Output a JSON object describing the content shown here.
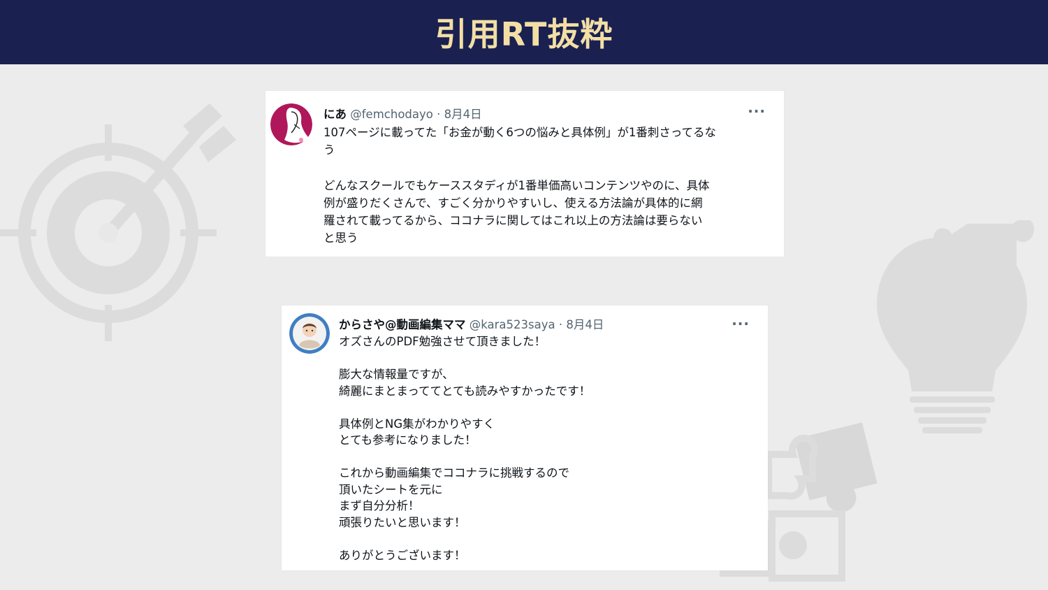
{
  "header": {
    "title": "引用RT抜粋"
  },
  "colors": {
    "header_bg": "#1a2150",
    "title": "#f3dfa6",
    "background": "#ececec",
    "deco": "#dcdcdc"
  },
  "decorations": [
    "target-arrow-icon",
    "lightbulb-puzzle-icon",
    "puzzle-pieces-icon"
  ],
  "tweets": [
    {
      "name": "にあ",
      "handle": "@femchodayo",
      "date": "· 8月4日",
      "more": "···",
      "paragraphs": [
        [
          "107ページに載ってた「お金が動く6つの悩みと具体例」が1番刺さってるな",
          "う"
        ],
        [
          "どんなスクールでもケーススタディが1番単価高いコンテンツやのに、具体",
          "例が盛りだくさんで、すごく分かりやすいし、使える方法論が具体的に網",
          "羅されて載ってるから、ココナラに関してはこれ以上の方法論は要らない",
          "と思う"
        ]
      ]
    },
    {
      "name": "からさや@動画編集ママ",
      "handle": "@kara523saya",
      "date": "· 8月4日",
      "more": "···",
      "paragraphs": [
        [
          "オズさんのPDF勉強させて頂きました！"
        ],
        [
          "膨大な情報量ですが、",
          "綺麗にまとまっててとても読みやすかったです！"
        ],
        [
          "具体例とNG集がわかりやすく",
          "とても参考になりました！"
        ],
        [
          "これから動画編集でココナラに挑戦するので",
          "頂いたシートを元に",
          "まず自分分析！",
          "頑張りたいと思います！"
        ],
        [
          "ありがとうございます！"
        ]
      ]
    }
  ]
}
